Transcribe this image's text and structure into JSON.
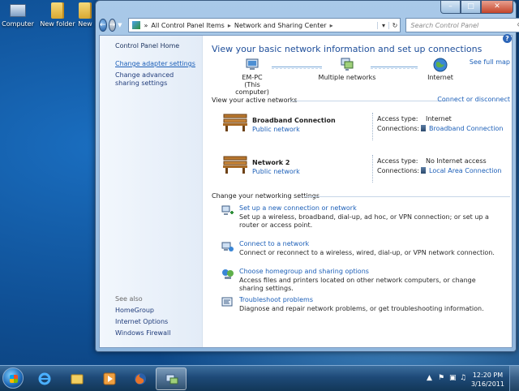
{
  "desktop": {
    "icons": [
      {
        "label": "Computer"
      },
      {
        "label": "New folder"
      },
      {
        "label": "New"
      }
    ]
  },
  "window": {
    "address": {
      "crumbs": [
        "All Control Panel Items",
        "Network and Sharing Center"
      ]
    },
    "search_placeholder": "Search Control Panel"
  },
  "left_pane": {
    "home": "Control Panel Home",
    "change_adapter": "Change adapter settings",
    "change_advanced": "Change advanced sharing settings",
    "see_also": "See also",
    "homegroup": "HomeGroup",
    "internet_options": "Internet Options",
    "firewall": "Windows Firewall"
  },
  "main": {
    "title": "View your basic network information and set up connections",
    "see_full_map": "See full map",
    "map": {
      "computer_name": "EM-PC",
      "computer_sub": "(This computer)",
      "middle": "Multiple networks",
      "internet": "Internet"
    },
    "active_header": "View your active networks",
    "connect_disconnect": "Connect or disconnect",
    "networks": [
      {
        "name": "Broadband Connection",
        "type": "Public network",
        "access_label": "Access type:",
        "access_value": "Internet",
        "conn_label": "Connections:",
        "conn_value": "Broadband Connection"
      },
      {
        "name": "Network  2",
        "type": "Public network",
        "access_label": "Access type:",
        "access_value": "No Internet access",
        "conn_label": "Connections:",
        "conn_value": "Local Area Connection"
      }
    ],
    "settings_header": "Change your networking settings",
    "tasks": [
      {
        "title": "Set up a new connection or network",
        "desc": "Set up a wireless, broadband, dial-up, ad hoc, or VPN connection; or set up a router or access point."
      },
      {
        "title": "Connect to a network",
        "desc": "Connect or reconnect to a wireless, wired, dial-up, or VPN network connection."
      },
      {
        "title": "Choose homegroup and sharing options",
        "desc": "Access files and printers located on other network computers, or change sharing settings."
      },
      {
        "title": "Troubleshoot problems",
        "desc": "Diagnose and repair network problems, or get troubleshooting information."
      }
    ]
  },
  "taskbar": {
    "time": "12:20 PM",
    "date": "3/16/2011"
  }
}
